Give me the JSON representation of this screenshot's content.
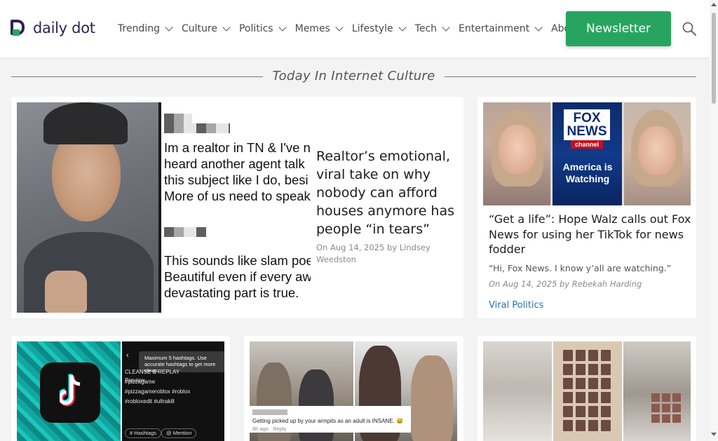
{
  "header": {
    "logo_text": "daily dot",
    "nav": [
      {
        "label": "Trending"
      },
      {
        "label": "Culture"
      },
      {
        "label": "Politics"
      },
      {
        "label": "Memes"
      },
      {
        "label": "Lifestyle"
      },
      {
        "label": "Tech"
      },
      {
        "label": "Entertainment"
      },
      {
        "label": "About"
      }
    ],
    "newsletter_label": "Newsletter",
    "search_icon": "search-icon"
  },
  "section": {
    "title": "Today In Internet Culture"
  },
  "hero": {
    "image_text_lines": [
      "Im a realtor in TN & I've n",
      "heard another agent talk",
      "this subject like I do, besi",
      "More of us need to speak",
      "This sounds like slam poe",
      "Beautiful even if every aw",
      "devastating part is true."
    ],
    "title": "Realtor’s emotional, viral take on why nobody can afford houses anymore has people “in tears”",
    "meta": "On Aug 14, 2025 by Lindsey Weedston"
  },
  "side": {
    "image_text": {
      "fox_brand": "FOX NEWS",
      "fox_channel": "channel",
      "tagline": "America is Watching"
    },
    "title": "“Get a life”: Hope Walz calls out Fox News for using her TikTok for news fodder",
    "quote": "“Hi, Fox News. I know y’all are watching.”",
    "meta": "On Aug 14, 2025 by Rebekah Harding",
    "tag": "Viral Politics"
  },
  "bottom": {
    "tiktok": {
      "tooltip": "Maximum 5 hashtags. Use accurate hashtags to get more views.",
      "tags": [
        "CLEANSE & REPLAY",
        "#pizzagame",
        "#pizzagameroblox #roblox",
        "#robloxedit #ultrakill"
      ],
      "pills": [
        "# Hashtags",
        "@ Mention"
      ],
      "preview": "Preview"
    },
    "plane": {
      "comment": "Getting picked up by your armpits as an adult is INSANE. 😅",
      "time": "8h ago",
      "reply": "Reply"
    }
  },
  "colors": {
    "brand_green": "#27a560",
    "brand_navy": "#2e2553",
    "link_blue": "#1f73b7"
  }
}
